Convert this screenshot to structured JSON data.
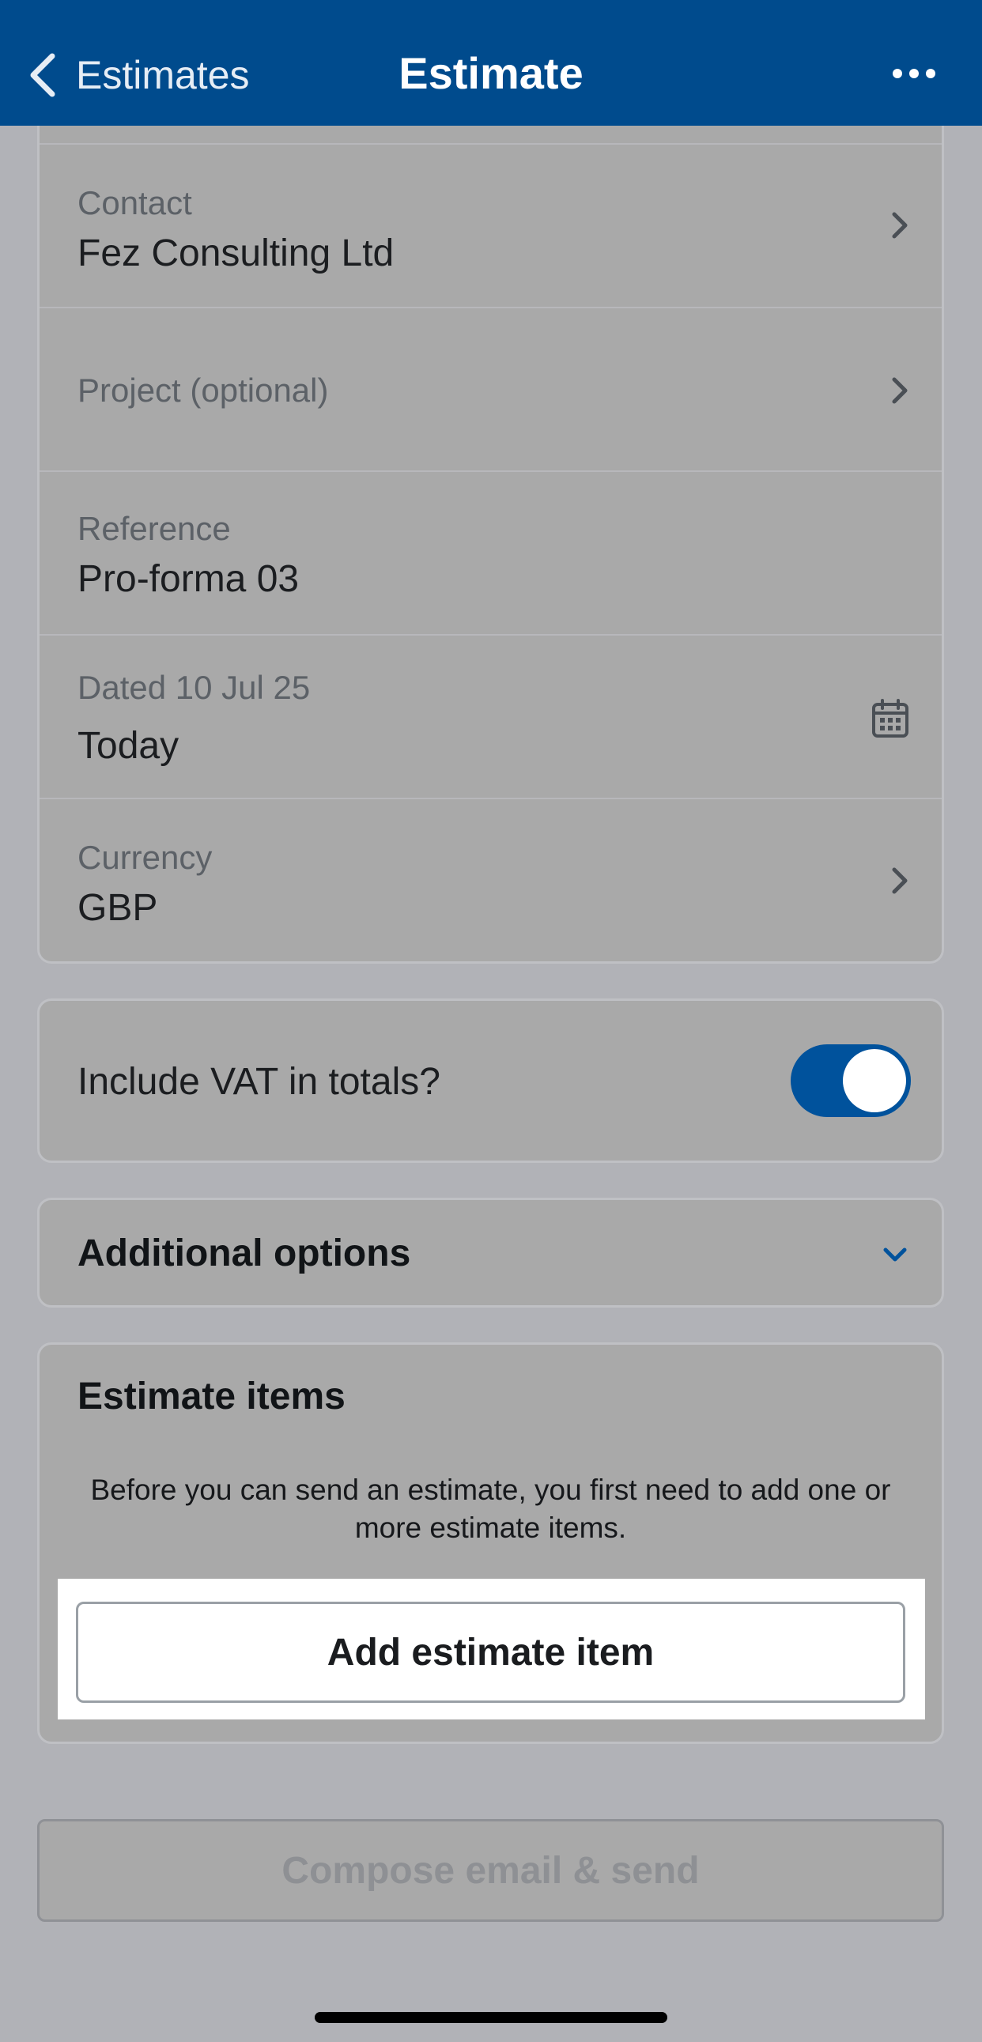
{
  "header": {
    "back_label": "Estimates",
    "title": "Estimate",
    "more_icon": "ellipsis-icon"
  },
  "details": {
    "contact": {
      "label": "Contact",
      "value": "Fez Consulting Ltd"
    },
    "project": {
      "label": "Project (optional)"
    },
    "reference": {
      "label": "Reference",
      "value": "Pro-forma 03"
    },
    "dated": {
      "label": "Dated 10 Jul 25",
      "value": "Today",
      "icon": "calendar-icon"
    },
    "currency": {
      "label": "Currency",
      "value": "GBP"
    }
  },
  "vat": {
    "label": "Include VAT in totals?",
    "enabled": true
  },
  "additional_options": {
    "label": "Additional options"
  },
  "estimate_items": {
    "heading": "Estimate items",
    "message": "Before you can send an estimate, you first need to add one or more estimate items.",
    "add_button": "Add estimate item"
  },
  "send_button": "Compose email & send",
  "colors": {
    "header_bg": "#004b8d",
    "toggle_on": "#00529c",
    "overlay_bg": "#b1b2b7"
  }
}
